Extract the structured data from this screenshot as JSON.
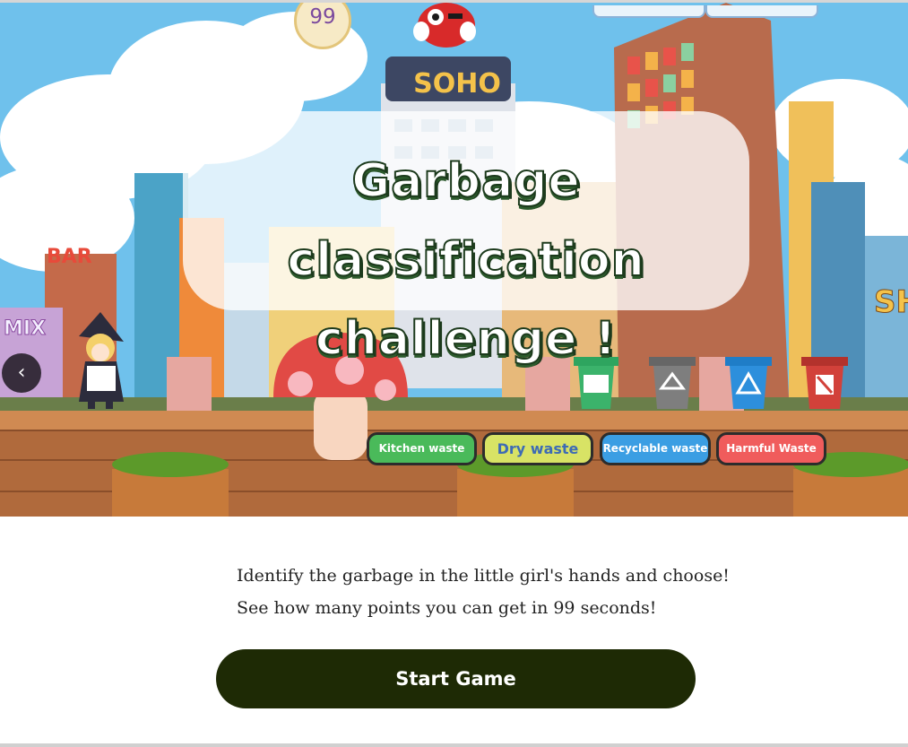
{
  "hud": {
    "timer_value": "99"
  },
  "title": {
    "line1": "Garbage classification",
    "line2": "challenge !"
  },
  "scene": {
    "signs": {
      "soho": "SOHO",
      "bar": "BAR",
      "mix": "MIX",
      "shop": "SH"
    }
  },
  "nav": {
    "prev_glyph": "‹"
  },
  "waste_buttons": [
    {
      "id": "kitchen",
      "label": "Kitchen waste",
      "color": "#4aba5a"
    },
    {
      "id": "dry",
      "label": "Dry waste",
      "color": "#d8e365"
    },
    {
      "id": "recyclable",
      "label": "Recyclable waste",
      "color": "#3b9ee3"
    },
    {
      "id": "harmful",
      "label": "Harmful Waste",
      "color": "#f05c5c"
    }
  ],
  "bins": [
    {
      "icon": "kitchen-bin-icon",
      "color": "#3bb36b"
    },
    {
      "icon": "dry-bin-icon",
      "color": "#7e7e7e"
    },
    {
      "icon": "recyclable-bin-icon",
      "color": "#2d8fdc"
    },
    {
      "icon": "harmful-bin-icon",
      "color": "#d2413a"
    }
  ],
  "instructions": {
    "line1": "Identify the garbage in the little girl's hands and choose!",
    "line2": "See how many points you can get in 99 seconds!"
  },
  "start_button": {
    "label": "Start Game",
    "color": "#1e2a05"
  }
}
